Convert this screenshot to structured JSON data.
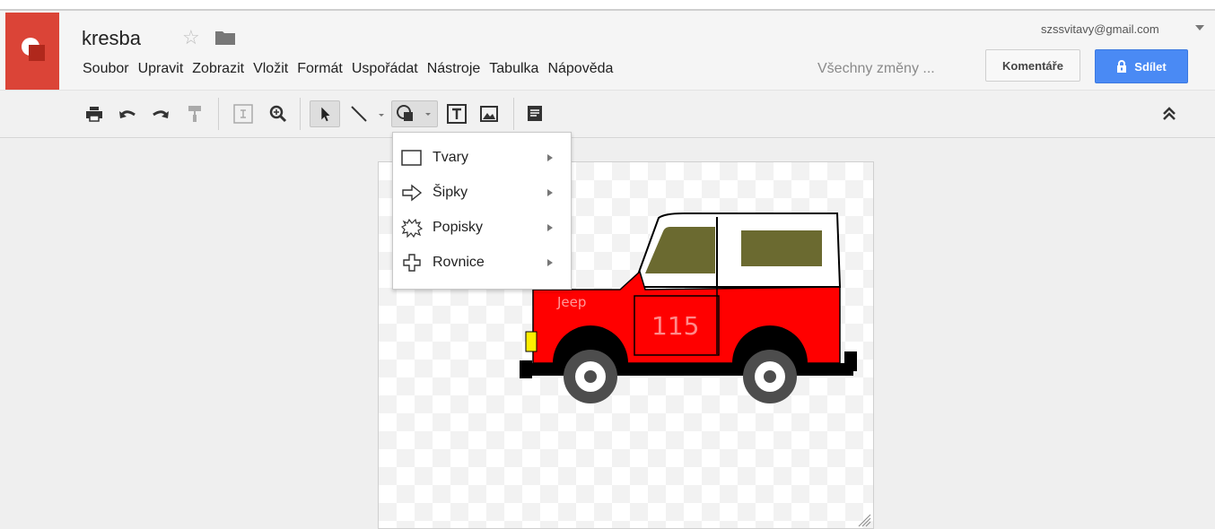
{
  "header": {
    "doc_title": "kresba",
    "user_email": "szssvitavy@gmail.com",
    "save_status": "Všechny změny ...",
    "comments_label": "Komentáře",
    "share_label": "Sdílet",
    "accent_color": "#4a8af4",
    "logo_color": "#db4437"
  },
  "menu": {
    "items": [
      "Soubor",
      "Upravit",
      "Zobrazit",
      "Vložit",
      "Formát",
      "Uspořádat",
      "Nástroje",
      "Tabulka",
      "Nápověda"
    ]
  },
  "toolbar": {
    "icons": [
      "print-icon",
      "undo-icon",
      "redo-icon",
      "paint-format-icon",
      "fit-icon",
      "zoom-icon",
      "select-icon",
      "line-icon",
      "shape-icon",
      "textbox-icon",
      "image-icon",
      "comment-icon",
      "collapse-icon"
    ]
  },
  "shapes_menu": {
    "items": [
      {
        "label": "Tvary",
        "icon": "rectangle-icon"
      },
      {
        "label": "Šipky",
        "icon": "arrow-icon"
      },
      {
        "label": "Popisky",
        "icon": "callout-icon"
      },
      {
        "label": "Rovnice",
        "icon": "plus-icon"
      }
    ]
  },
  "drawing": {
    "brand_text": "Jeep",
    "number_text": "115",
    "body_color": "#ff0000",
    "window_color": "#6b6a30"
  }
}
